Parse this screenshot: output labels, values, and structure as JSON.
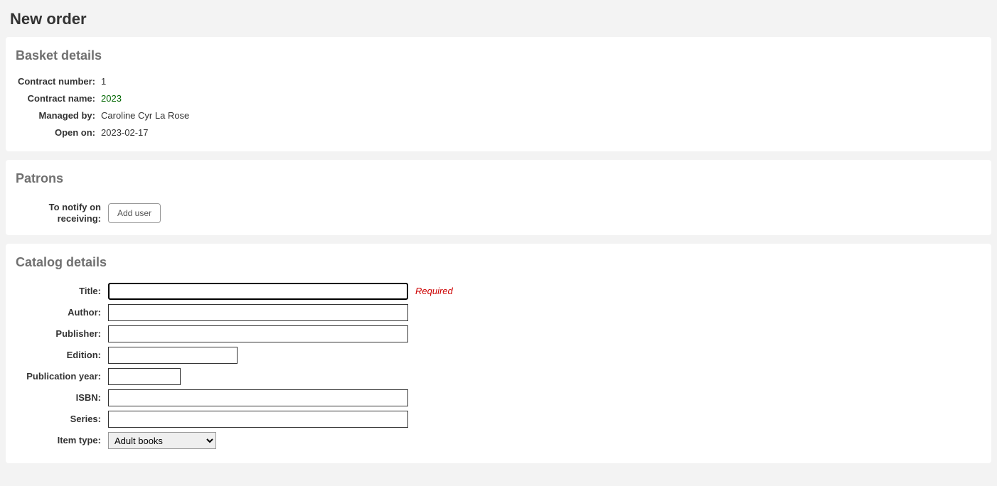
{
  "page": {
    "title": "New order"
  },
  "basket": {
    "legend": "Basket details",
    "fields": {
      "contract_number": {
        "label": "Contract number:",
        "value": "1"
      },
      "contract_name": {
        "label": "Contract name:",
        "value": "2023"
      },
      "managed_by": {
        "label": "Managed by:",
        "value": "Caroline Cyr La Rose"
      },
      "open_on": {
        "label": "Open on:",
        "value": "2023-02-17"
      }
    }
  },
  "patrons": {
    "legend": "Patrons",
    "notify_label": "To notify on receiving:",
    "add_user_label": "Add user"
  },
  "catalog": {
    "legend": "Catalog details",
    "required_text": "Required",
    "fields": {
      "title": {
        "label": "Title:",
        "value": ""
      },
      "author": {
        "label": "Author:",
        "value": ""
      },
      "publisher": {
        "label": "Publisher:",
        "value": ""
      },
      "edition": {
        "label": "Edition:",
        "value": ""
      },
      "publication_year": {
        "label": "Publication year:",
        "value": ""
      },
      "isbn": {
        "label": "ISBN:",
        "value": ""
      },
      "series": {
        "label": "Series:",
        "value": ""
      },
      "item_type": {
        "label": "Item type:",
        "value": "Adult books"
      }
    }
  }
}
